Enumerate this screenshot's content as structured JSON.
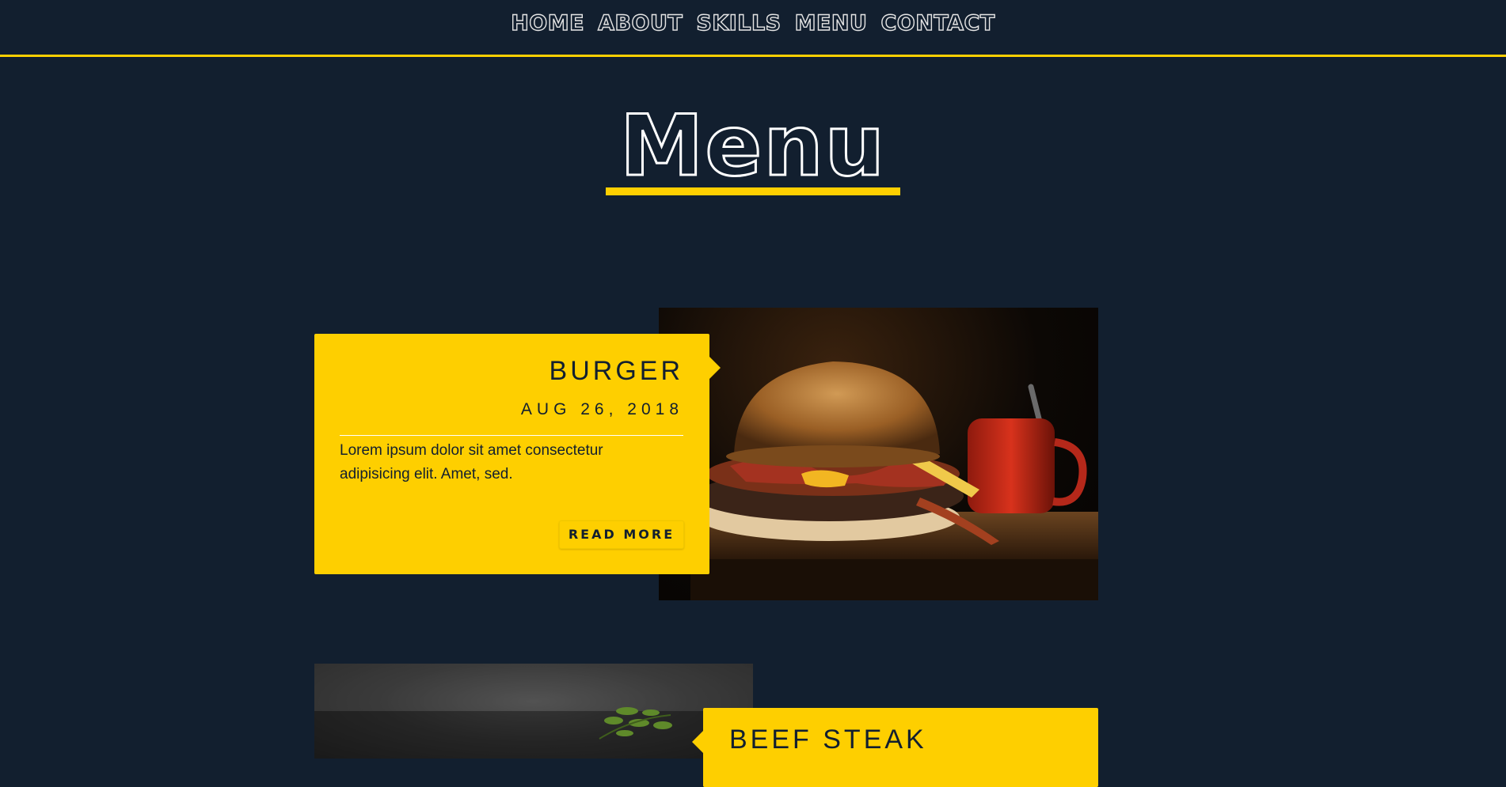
{
  "nav": {
    "items": [
      "HOME",
      "ABOUT",
      "SKILLS",
      "MENU",
      "CONTACT"
    ]
  },
  "page": {
    "title": "Menu"
  },
  "menu_items": [
    {
      "name": "BURGER",
      "date": "AUG 26, 2018",
      "description": "Lorem ipsum dolor sit amet consectetur adipisicing elit. Amet, sed.",
      "button_label": "READ MORE"
    },
    {
      "name": "BEEF STEAK"
    }
  ],
  "colors": {
    "background": "#121f2f",
    "accent": "#fecf00",
    "nav_text": "#e4e4e4",
    "card_text": "#121f2f"
  }
}
